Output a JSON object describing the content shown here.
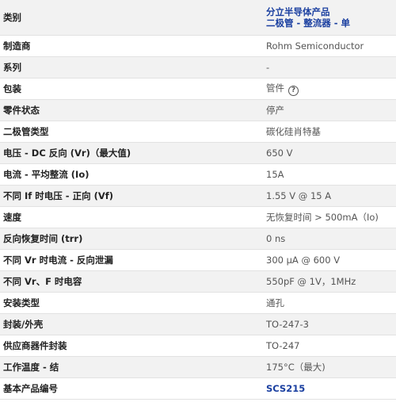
{
  "rows": [
    {
      "label": "类别",
      "lines": [
        "分立半导体产品",
        "二极管 - 整流器 - 单"
      ]
    },
    {
      "label": "制造商",
      "value": "Rohm Semiconductor"
    },
    {
      "label": "系列",
      "value": "-"
    },
    {
      "label": "包装",
      "value": "管件"
    },
    {
      "label": "零件状态",
      "value": "停产"
    },
    {
      "label": "二极管类型",
      "value": "碳化硅肖特基"
    },
    {
      "label": "电压 - DC 反向 (Vr)（最大值)",
      "value": "650 V"
    },
    {
      "label": "电流 - 平均整流 (Io)",
      "value": "15A"
    },
    {
      "label": "不同 If 时电压 - 正向 (Vf)",
      "value": "1.55 V @ 15 A"
    },
    {
      "label": "速度",
      "value": "无恢复时间 > 500mA（Io)"
    },
    {
      "label": "反向恢复时间 (trr)",
      "value": "0 ns"
    },
    {
      "label": "不同 Vr 时电流 - 反向泄漏",
      "value": "300 µA @ 600 V"
    },
    {
      "label": "不同 Vr、F 时电容",
      "value": "550pF @ 1V，1MHz"
    },
    {
      "label": "安装类型",
      "value": "通孔"
    },
    {
      "label": "封装/外壳",
      "value": "TO-247-3"
    },
    {
      "label": "供应商器件封装",
      "value": "TO-247"
    },
    {
      "label": "工作温度 - 结",
      "value": "175°C（最大)"
    },
    {
      "label": "基本产品编号",
      "value": "SCS215"
    }
  ],
  "help_icon_glyph": "?",
  "colors": {
    "link": "#1a3fa0",
    "alt_row": "#f2f2f2",
    "border": "#e2e2e2"
  }
}
